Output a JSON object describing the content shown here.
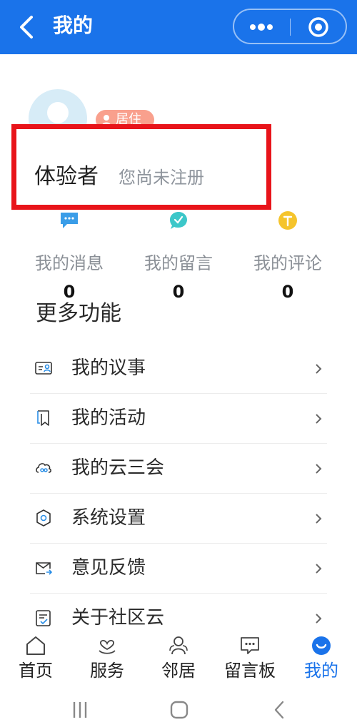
{
  "header": {
    "title": "我的",
    "bg_color": "#1a73ea",
    "back_icon": "chevron-left-icon",
    "more_icon": "more-dots-icon",
    "close_icon": "target-icon"
  },
  "profile": {
    "badge": "居住",
    "name": "体验者",
    "status": "您尚未注册",
    "highlight_color": "#e8141a"
  },
  "stats": [
    {
      "label": "我的消息",
      "count": "0",
      "icon": "message-icon",
      "color": "#3a9de8"
    },
    {
      "label": "我的留言",
      "count": "0",
      "icon": "comment-check-icon",
      "color": "#3cc7c9"
    },
    {
      "label": "我的评论",
      "count": "0",
      "icon": "review-icon",
      "color": "#f5c42c"
    }
  ],
  "more": {
    "title": "更多功能",
    "items": [
      {
        "label": "我的议事",
        "icon": "discussion-card-icon"
      },
      {
        "label": "我的活动",
        "icon": "activity-book-icon"
      },
      {
        "label": "我的云三会",
        "icon": "cloud-meeting-icon"
      },
      {
        "label": "系统设置",
        "icon": "settings-icon"
      },
      {
        "label": "意见反馈",
        "icon": "feedback-mail-icon"
      },
      {
        "label": "关于社区云",
        "icon": "about-icon"
      }
    ]
  },
  "tabbar": {
    "items": [
      {
        "label": "首页",
        "icon": "home-icon"
      },
      {
        "label": "服务",
        "icon": "service-heart-icon"
      },
      {
        "label": "邻居",
        "icon": "neighbors-icon"
      },
      {
        "label": "留言板",
        "icon": "message-board-icon"
      },
      {
        "label": "我的",
        "icon": "profile-icon",
        "active": true
      }
    ],
    "active_color": "#1a73ea"
  },
  "system_nav": {
    "recents": "recents-icon",
    "home": "home-circle-icon",
    "back": "back-icon"
  }
}
